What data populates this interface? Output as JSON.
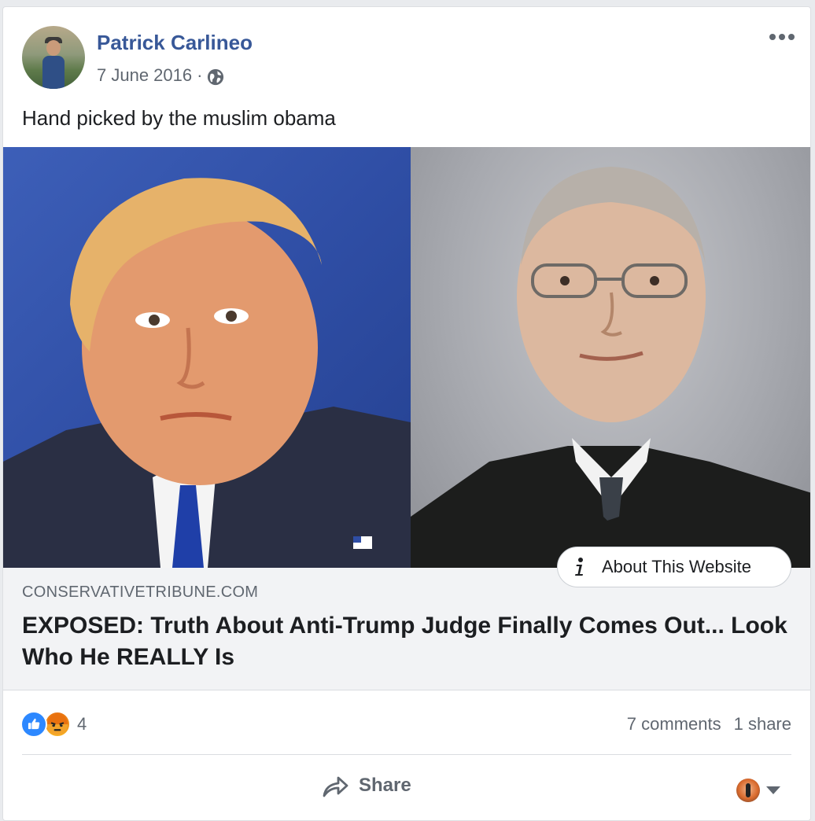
{
  "post": {
    "author": "Patrick Carlineo",
    "date": "7 June 2016",
    "separator": "·",
    "privacy_icon": "globe-icon",
    "text": "Hand picked by the muslim obama"
  },
  "link": {
    "about_label": "About This Website",
    "domain": "CONSERVATIVETRIBUNE.COM",
    "title": "EXPOSED: Truth About Anti-Trump Judge Finally Comes Out... Look Who He REALLY Is"
  },
  "stats": {
    "reaction_icons": [
      "like-icon",
      "angry-icon"
    ],
    "reaction_count": "4",
    "comments": "7 comments",
    "shares": "1 share"
  },
  "actions": {
    "share_label": "Share"
  },
  "colors": {
    "link_blue": "#385898",
    "secondary_text": "#606770",
    "like_blue": "#2d88ff"
  }
}
